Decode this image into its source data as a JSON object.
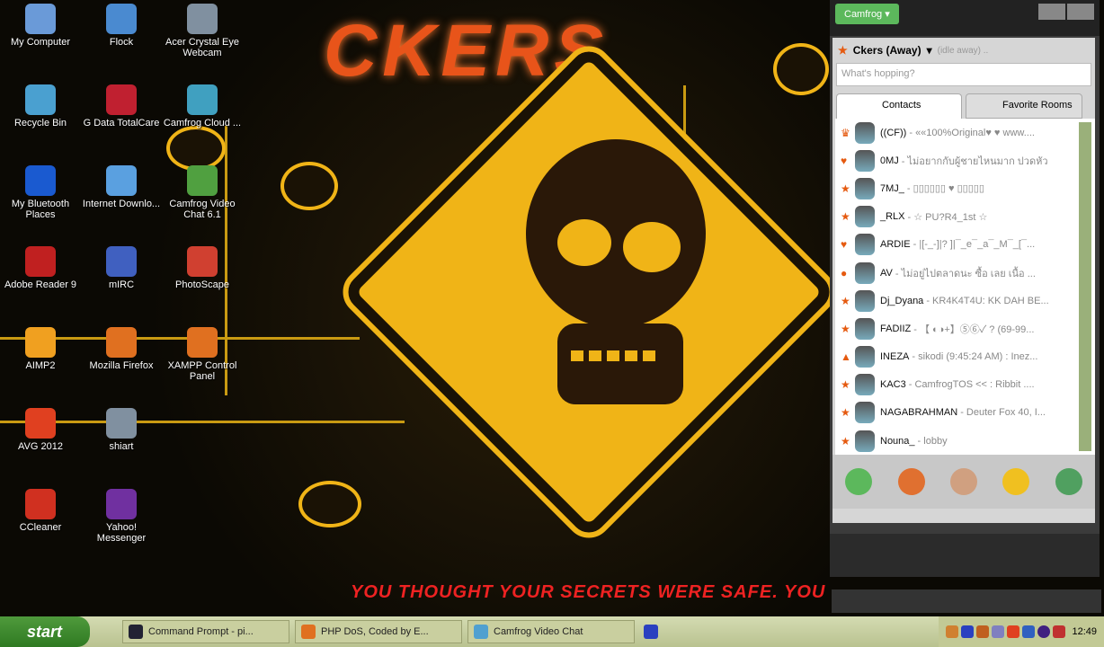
{
  "wallpaper": {
    "title": "CKERS",
    "slogan": "YOU THOUGHT YOUR SECRETS WERE SAFE. YOU"
  },
  "desktop_icons": [
    {
      "label": "My Computer",
      "color": "#6a9ad8"
    },
    {
      "label": "Recycle Bin",
      "color": "#4aa0d0"
    },
    {
      "label": "My Bluetooth Places",
      "color": "#1a5ad0"
    },
    {
      "label": "Adobe Reader 9",
      "color": "#c02020"
    },
    {
      "label": "AIMP2",
      "color": "#f0a020"
    },
    {
      "label": "AVG 2012",
      "color": "#e04020"
    },
    {
      "label": "CCleaner",
      "color": "#d03020"
    },
    {
      "label": "Flock",
      "color": "#4a8ad0"
    },
    {
      "label": "G Data TotalCare",
      "color": "#c02030"
    },
    {
      "label": "Internet Downlo...",
      "color": "#5aa0e0"
    },
    {
      "label": "mIRC",
      "color": "#4060c0"
    },
    {
      "label": "Mozilla Firefox",
      "color": "#e07020"
    },
    {
      "label": "shiart",
      "color": "#8090a0"
    },
    {
      "label": "Yahoo! Messenger",
      "color": "#7030a0"
    },
    {
      "label": "Acer Crystal Eye Webcam",
      "color": "#8090a0"
    },
    {
      "label": "Camfrog Cloud ...",
      "color": "#40a0c0"
    },
    {
      "label": "Camfrog Video Chat 6.1",
      "color": "#50a040"
    },
    {
      "label": "PhotoScape",
      "color": "#d04030"
    },
    {
      "label": "XAMPP Control Panel",
      "color": "#e07020"
    }
  ],
  "camfrog": {
    "menu_button": "Camfrog ▾",
    "user": "Ckers (Away)",
    "user_status": "(idle away) ..",
    "status_placeholder": "What's hopping?",
    "tabs": [
      "Contacts",
      "Favorite Rooms"
    ],
    "contacts": [
      {
        "badge": "♛",
        "name": "((CF))",
        "msg": "««100%Original♥ ♥ www...."
      },
      {
        "badge": "♥",
        "name": "0MJ",
        "msg": "ไม่อยากกับผู้ชายไหนมาก ปวดหัว"
      },
      {
        "badge": "★",
        "name": "7MJ_",
        "msg": "▯▯▯▯▯▯ ♥ ▯▯▯▯▯"
      },
      {
        "badge": "★",
        "name": "_RLX",
        "msg": "☆ PU?R4_1st ☆"
      },
      {
        "badge": "♥",
        "name": "ARDIE",
        "msg": "|[-_-]|? ]|¯_e¯_a¯_M¯_[¯..."
      },
      {
        "badge": "●",
        "name": "AV",
        "msg": "ไม่อยู่ไปตลาดนะ ซื้อ เลย เนื้อ ..."
      },
      {
        "badge": "★",
        "name": "Dj_Dyana",
        "msg": "KR4K4T4U: KK DAH BE..."
      },
      {
        "badge": "★",
        "name": "FADIIZ",
        "msg": "【 ◐◑+】⑤⑥✓ ? (69-99..."
      },
      {
        "badge": "▲",
        "name": "INEZA",
        "msg": "sikodi (9:45:24 AM) : Inez..."
      },
      {
        "badge": "★",
        "name": "KAC3",
        "msg": "CamfrogTOS << : Ribbit ...."
      },
      {
        "badge": "★",
        "name": "NAGABRAHMAN",
        "msg": "Deuter Fox 40, I..."
      },
      {
        "badge": "★",
        "name": "Nouna_",
        "msg": "lobby"
      }
    ]
  },
  "taskbar": {
    "start": "start",
    "tasks": [
      "Command Prompt - pi...",
      "PHP DoS, Coded by E...",
      "Camfrog Video Chat"
    ],
    "clock": "12:49"
  }
}
